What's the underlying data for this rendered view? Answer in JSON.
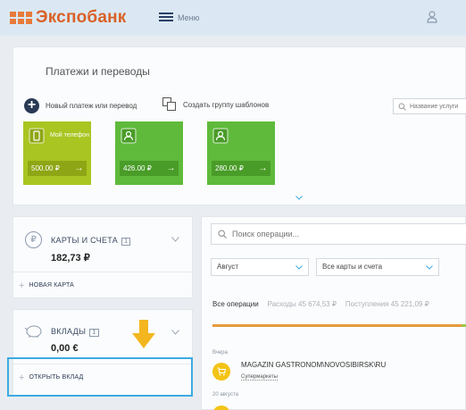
{
  "header": {
    "logo": "Экспобанк",
    "menu_label": "Меню",
    "colors": {
      "background": "#dbe8f4",
      "logo": "#d96127",
      "logo_mark": "#e87a3c"
    },
    "icons": [
      "logo-mark-icon",
      "hamburger-icon",
      "user-icon"
    ]
  },
  "payments": {
    "title": "Платежи и переводы",
    "new_payment": "Новый платеж или перевод",
    "group_templates": "Создать группу шаблонов",
    "search_placeholder": "Название услуги",
    "tiles": [
      {
        "name": "Мой телефон",
        "amount": "500.00  ₽",
        "arrow": "→",
        "color": "#a9c521",
        "dark": "#8ea615",
        "icon": "phone-icon"
      },
      {
        "name": "",
        "amount": "426.00  ₽",
        "arrow": "→",
        "color": "#5fba3b",
        "dark": "#499c28",
        "icon": "person-icon"
      },
      {
        "name": "",
        "amount": "280.00  ₽",
        "arrow": "→",
        "color": "#5fba3b",
        "dark": "#499c28",
        "icon": "person-icon"
      }
    ]
  },
  "accounts": {
    "title": "КАРТЫ И СЧЕТА",
    "count": "1",
    "balance": "182,73 ₽",
    "action": "НОВАЯ КАРТА",
    "icon": "ruble-icon"
  },
  "deposits": {
    "title": "ВКЛАДЫ",
    "count": "1",
    "balance": "0,00 €",
    "action": "ОТКРЫТЬ ВКЛАД",
    "icon": "piggy-bank-icon",
    "highlight_color": "#3cabe3",
    "arrow_color": "#f3b61f"
  },
  "operations": {
    "search_placeholder": "Поиск операции...",
    "month": "Август",
    "cards_filter": "Все карты и счета",
    "tabs": [
      {
        "label": "Все операции",
        "active": true
      },
      {
        "label": "Расходы 45 674,53 ₽",
        "active": false
      },
      {
        "label": "Поступления 45 221,09 ₽",
        "active": false
      }
    ],
    "income_share": 0.02,
    "bar_colors": {
      "expenses": "#e79a3d",
      "income": "#9cc64a"
    },
    "days": [
      "Вчера",
      "20 августа"
    ],
    "items": [
      {
        "name": "MAGAZIN GASTRONOM\\NOVOSIBIRSK\\RU",
        "category": "Супермаркеты",
        "icon": "shopping-cart-icon"
      }
    ]
  }
}
